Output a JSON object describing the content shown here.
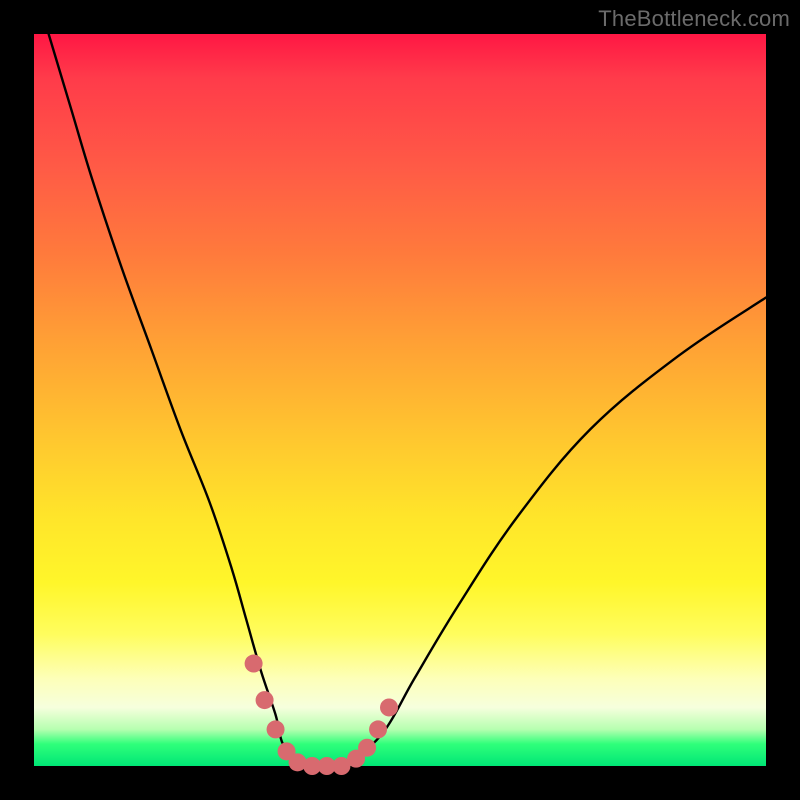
{
  "watermark": {
    "text": "TheBottleneck.com"
  },
  "colors": {
    "background": "#000000",
    "curve_main": "#000000",
    "overlay_dots": "#d86a6f"
  },
  "chart_data": {
    "type": "line",
    "title": "",
    "xlabel": "",
    "ylabel": "",
    "xlim": [
      0,
      100
    ],
    "ylim": [
      0,
      100
    ],
    "grid": false,
    "legend": false,
    "series": [
      {
        "name": "bottleneck-curve",
        "x": [
          2,
          5,
          8,
          12,
          16,
          20,
          24,
          27,
          29,
          31,
          33,
          34,
          36,
          38,
          40,
          42,
          44,
          48,
          52,
          58,
          66,
          76,
          88,
          100
        ],
        "values": [
          100,
          90,
          80,
          68,
          57,
          46,
          36,
          27,
          20,
          13,
          7,
          3,
          1,
          0,
          0,
          0,
          1,
          5,
          12,
          22,
          34,
          46,
          56,
          64
        ]
      }
    ],
    "overlay_points": {
      "name": "highlighted-range",
      "color": "#d86a6f",
      "x": [
        30,
        31.5,
        33,
        34.5,
        36,
        38,
        40,
        42,
        44,
        45.5,
        47,
        48.5
      ],
      "values": [
        14,
        9,
        5,
        2,
        0.5,
        0,
        0,
        0,
        1,
        2.5,
        5,
        8
      ]
    }
  }
}
